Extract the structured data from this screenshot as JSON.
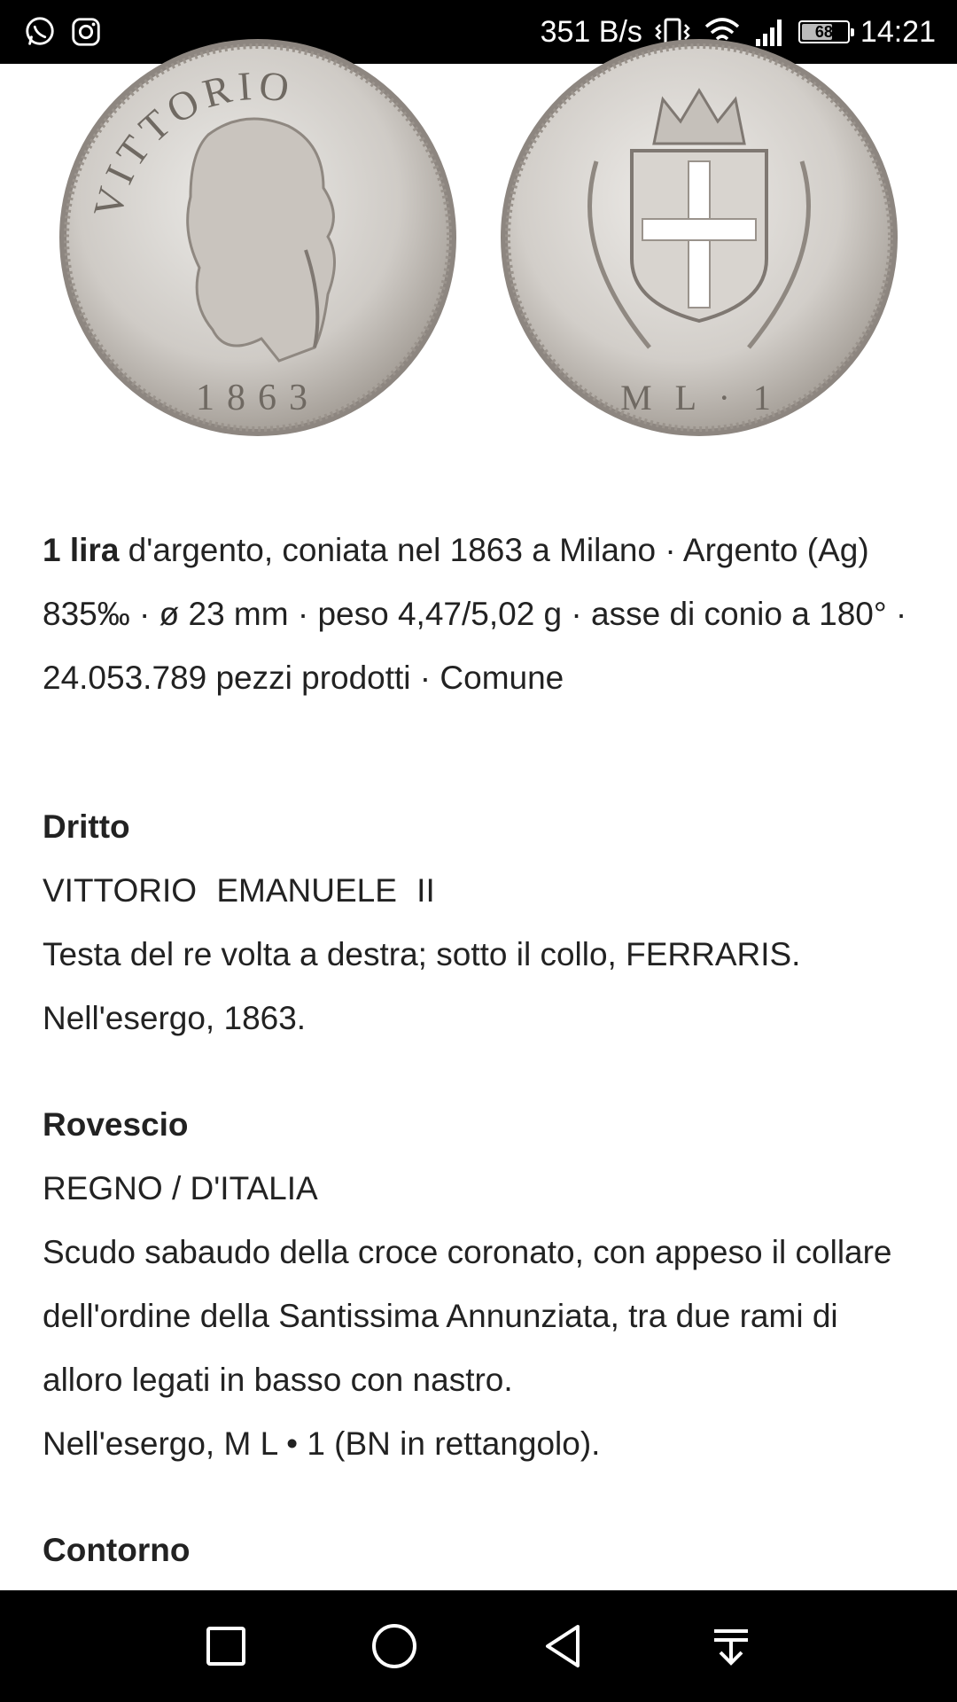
{
  "status_bar": {
    "apps": [
      "whatsapp-icon",
      "instagram-icon"
    ],
    "net_speed": "351 B/s",
    "battery_level": "68",
    "time": "14:21"
  },
  "coins": {
    "obverse": {
      "legend_left": "VITTORIO",
      "legend_right": "EMANUELE II",
      "year": "1863",
      "engraver": "FERRARIS"
    },
    "reverse": {
      "legend_left": "REGNO",
      "legend_right": "D'ITALIA",
      "exergue": "M  L · 1"
    }
  },
  "article": {
    "lead_bold": "1 lira",
    "lead_text": " d'argento, coniata nel 1863 a Milano · Argento (Ag) 835‰ · ø 23 mm · peso 4,47/5,02 g · asse di conio a 180° · 24.053.789 pezzi prodotti · Comune",
    "dritto": {
      "title": "Dritto",
      "legend": "VITTORIO  EMANUELE  II",
      "desc1": "Testa del re volta a destra; sotto il collo, FERRARIS.",
      "desc2": "Nell'esergo, 1863."
    },
    "rovescio": {
      "title": "Rovescio",
      "legend": "REGNO  /  D'ITALIA",
      "desc1": "Scudo sabaudo della croce coronato, con appeso il collare dell'ordine della Santissima Annunziata, tra due rami di alloro legati in basso con nastro.",
      "desc2": "Nell'esergo, M  L • 1  (BN in rettangolo)."
    },
    "contorno": {
      "title": "Contorno"
    }
  },
  "nav": {
    "recents": "recents-square-icon",
    "home": "home-circle-icon",
    "back": "back-triangle-icon",
    "notifications": "pull-down-icon"
  }
}
